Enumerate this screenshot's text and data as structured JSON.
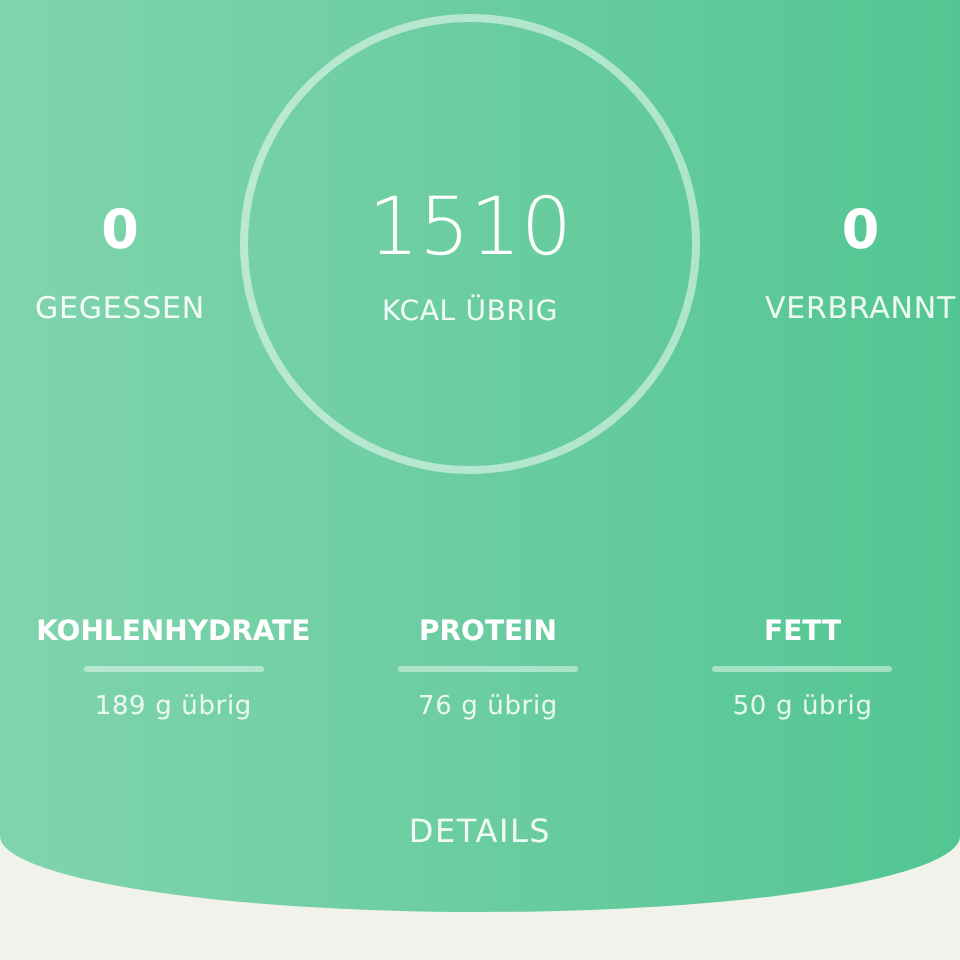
{
  "summary": {
    "eaten": {
      "value": "0",
      "label": "GEGESSEN"
    },
    "remaining": {
      "value": "1510",
      "label": "KCAL ÜBRIG"
    },
    "burned": {
      "value": "0",
      "label": "VERBRANNT"
    }
  },
  "macros": [
    {
      "name": "KOHLENHYDRATE",
      "level": 0,
      "reading": "189 g übrig"
    },
    {
      "name": "PROTEIN",
      "level": 0,
      "reading": "76 g übrig"
    },
    {
      "name": "FETT",
      "level": 0,
      "reading": "50 g übrig"
    }
  ],
  "details_link": "DETAILS"
}
